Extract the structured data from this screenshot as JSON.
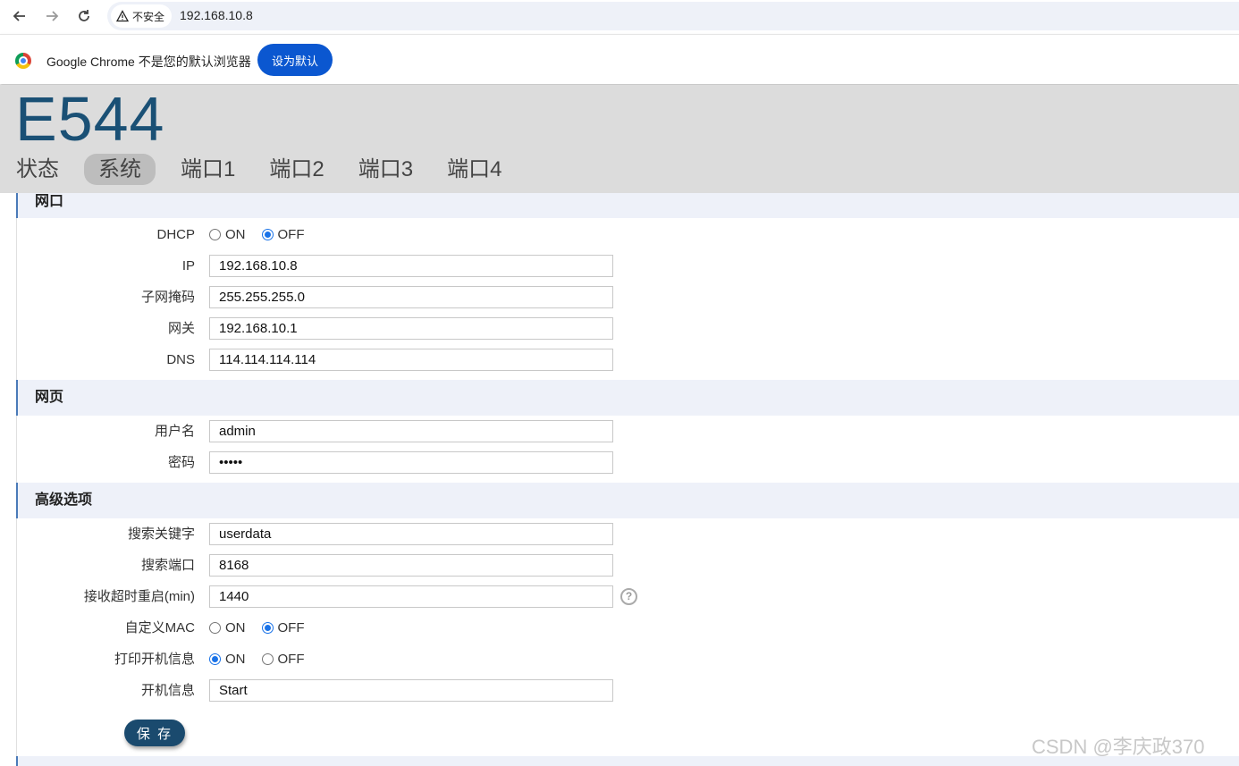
{
  "browser": {
    "security_label": "不安全",
    "url": "192.168.10.8",
    "infobar_text": "Google Chrome 不是您的默认浏览器",
    "infobar_button": "设为默认"
  },
  "header": {
    "title": "E544",
    "tabs": [
      "状态",
      "系统",
      "端口1",
      "端口2",
      "端口3",
      "端口4"
    ],
    "active_tab": "系统"
  },
  "network": {
    "section_title": "网口",
    "dhcp_label": "DHCP",
    "dhcp_on": "ON",
    "dhcp_off": "OFF",
    "dhcp_value": "OFF",
    "ip_label": "IP",
    "ip_value": "192.168.10.8",
    "mask_label": "子网掩码",
    "mask_value": "255.255.255.0",
    "gateway_label": "网关",
    "gateway_value": "192.168.10.1",
    "dns_label": "DNS",
    "dns_value": "114.114.114.114"
  },
  "web": {
    "section_title": "网页",
    "username_label": "用户名",
    "username_value": "admin",
    "password_label": "密码",
    "password_value": "•••••"
  },
  "advanced": {
    "section_title": "高级选项",
    "search_keyword_label": "搜索关键字",
    "search_keyword_value": "userdata",
    "search_port_label": "搜索端口",
    "search_port_value": "8168",
    "timeout_label": "接收超时重启(min)",
    "timeout_value": "1440",
    "help_glyph": "?",
    "custom_mac_label": "自定义MAC",
    "custom_mac_on": "ON",
    "custom_mac_off": "OFF",
    "custom_mac_value": "OFF",
    "print_boot_label": "打印开机信息",
    "print_boot_on": "ON",
    "print_boot_off": "OFF",
    "print_boot_value": "ON",
    "boot_msg_label": "开机信息",
    "boot_msg_value": "Start"
  },
  "save_button": "保 存",
  "watermark": "CSDN @李庆政370",
  "colors": {
    "accent": "#1a5075",
    "section_bg": "#eef1f9",
    "primary_button": "#0b57d0"
  }
}
